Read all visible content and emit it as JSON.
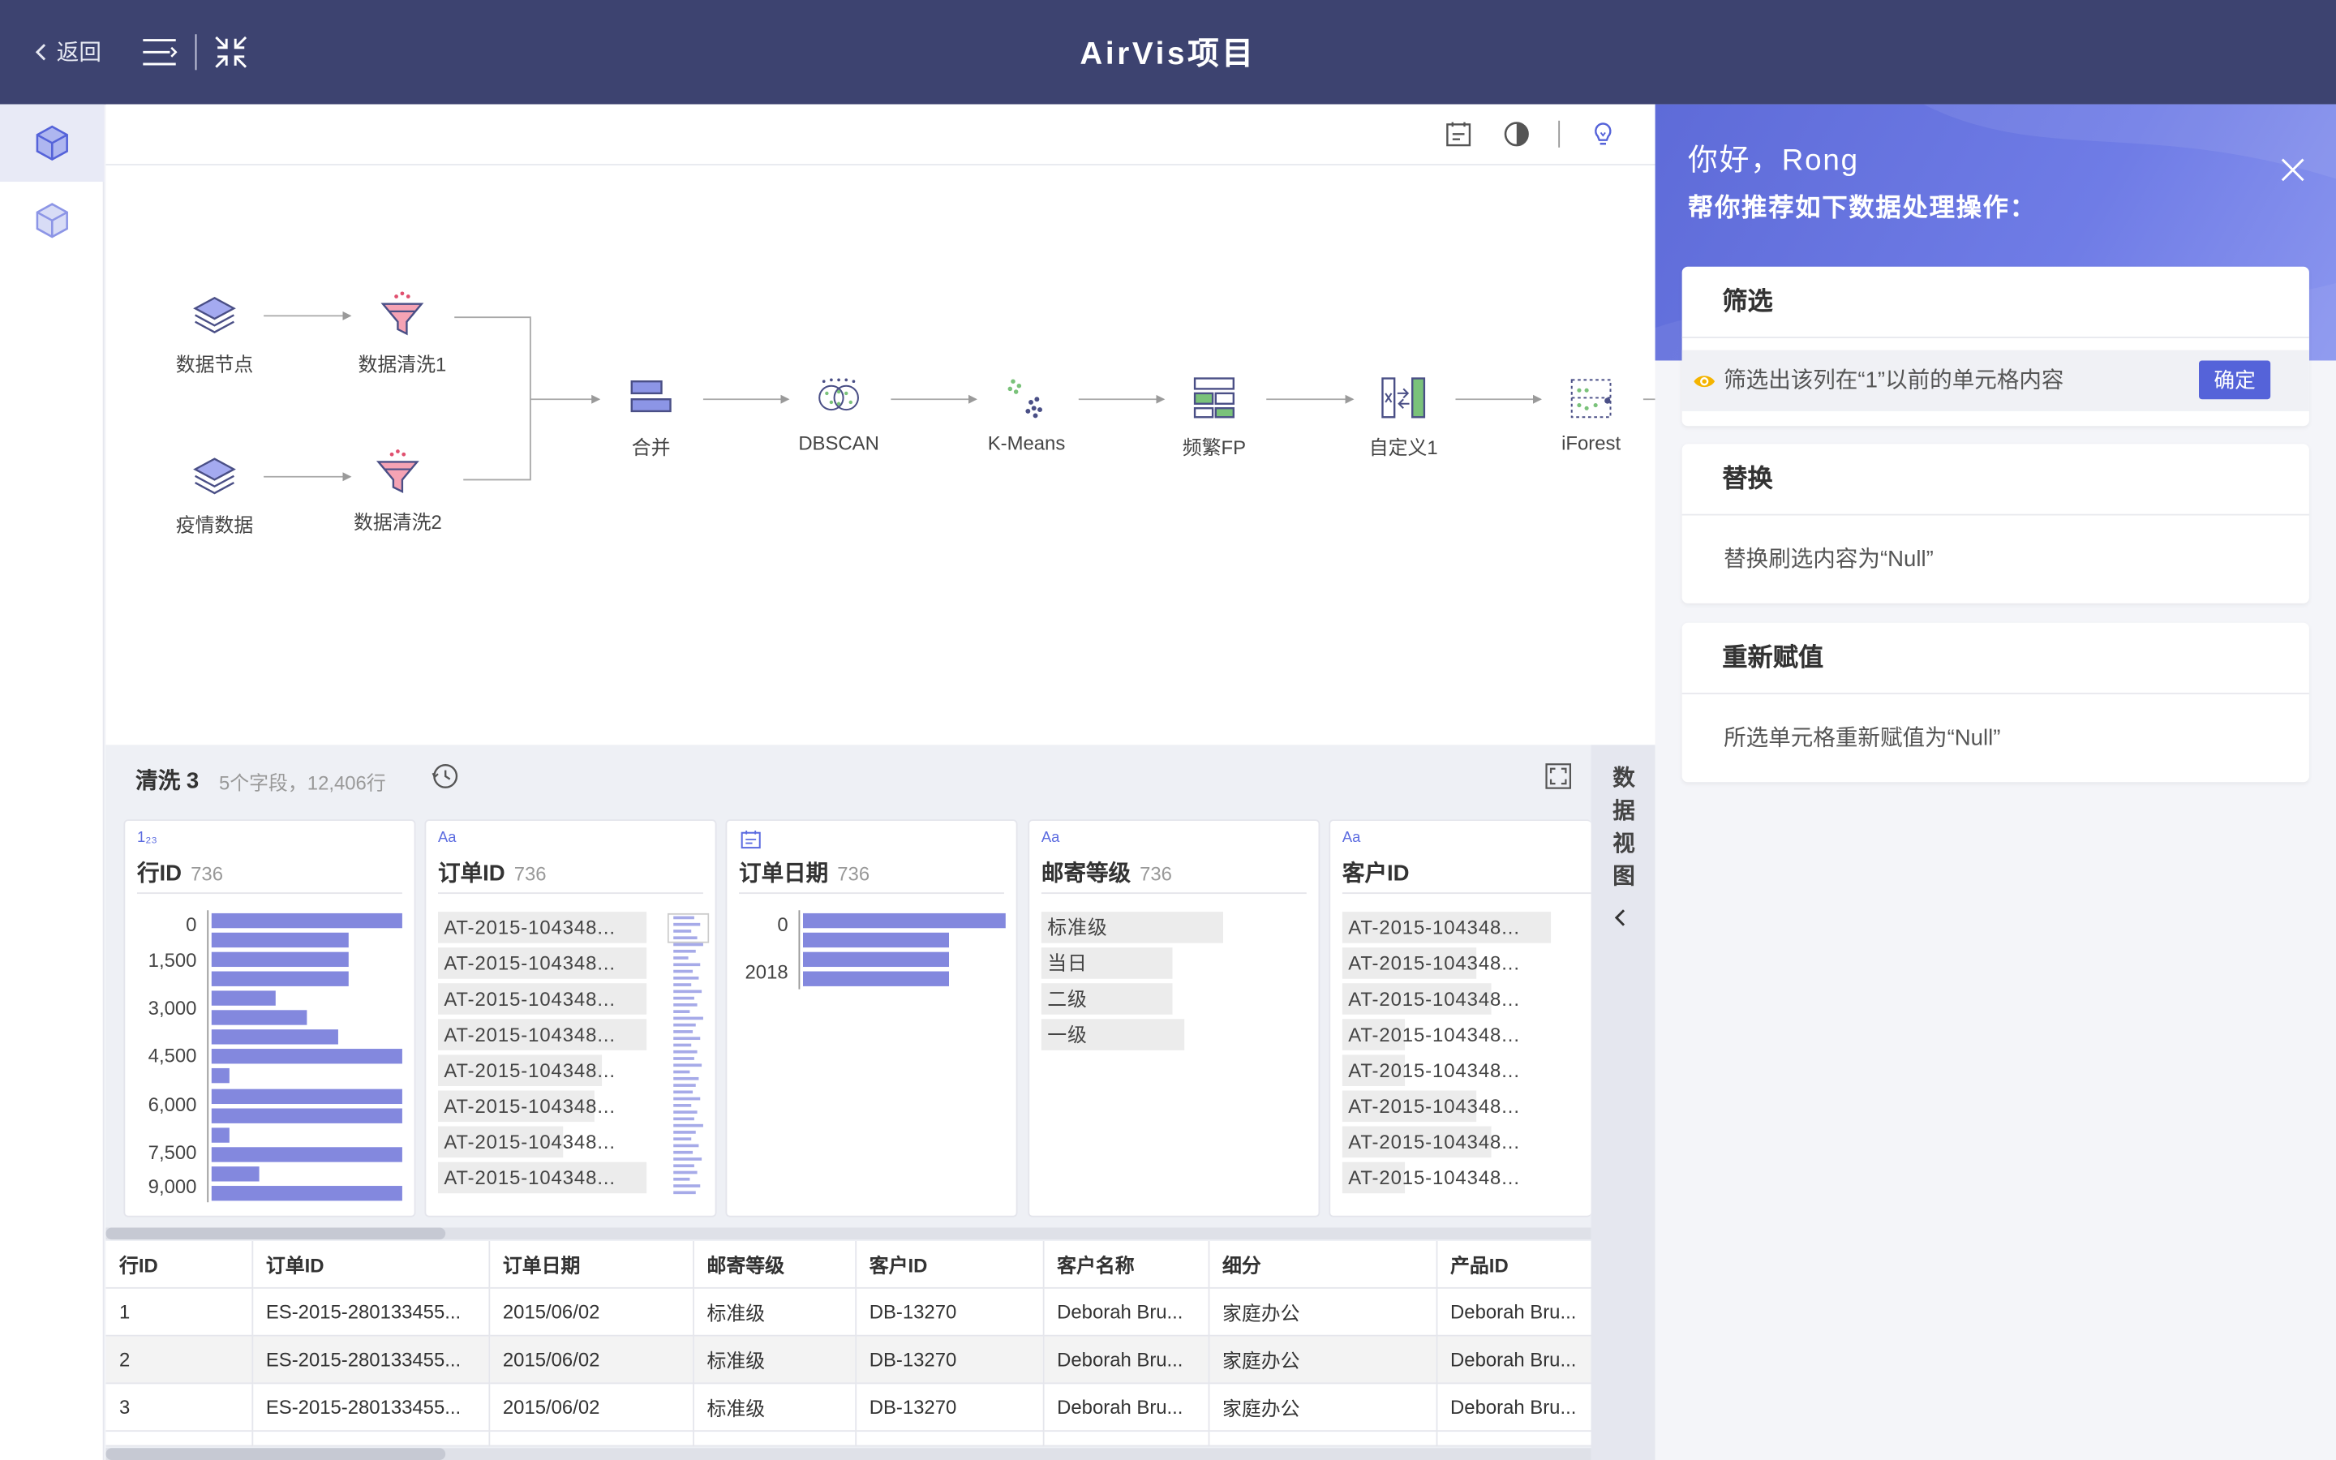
{
  "app": {
    "title": "AirVis项目",
    "back_label": "返回"
  },
  "colors": {
    "topbar": "#3d4370",
    "accent": "#5563d9",
    "bar": "#8388de"
  },
  "toolbar_icons": [
    "menu-icon",
    "collapse-icon"
  ],
  "canvas_toolbar_icons": [
    "calendar-icon",
    "contrast-icon",
    "lightbulb-icon"
  ],
  "flow": {
    "nodes": [
      {
        "label": "数据节点",
        "icon": "layers-icon"
      },
      {
        "label": "数据清洗1",
        "icon": "funnel-icon"
      },
      {
        "label": "疫情数据",
        "icon": "layers-icon"
      },
      {
        "label": "数据清洗2",
        "icon": "funnel-icon"
      },
      {
        "label": "合并",
        "icon": "merge-icon"
      },
      {
        "label": "DBSCAN",
        "icon": "dbscan-icon"
      },
      {
        "label": "K-Means",
        "icon": "kmeans-icon"
      },
      {
        "label": "频繁FP",
        "icon": "fp-icon"
      },
      {
        "label": "自定义1",
        "icon": "custom-icon"
      },
      {
        "label": "iForest",
        "icon": "iforest-icon"
      }
    ]
  },
  "data_panel": {
    "title": "清洗 3",
    "subtitle": "5个字段，12,406行",
    "side_tab": "数据视图",
    "columns": [
      {
        "type": "1₂₃",
        "name": "行ID",
        "count": "736",
        "ticks": [
          "0",
          "1,500",
          "3,000",
          "4,500",
          "6,000",
          "7,500",
          "9,000"
        ]
      },
      {
        "type": "Aa",
        "name": "订单ID",
        "count": "736",
        "values": [
          "AT-2015-104348...",
          "AT-2015-104348...",
          "AT-2015-104348...",
          "AT-2015-104348...",
          "AT-2015-104348...",
          "AT-2015-104348...",
          "AT-2015-104348...",
          "AT-2015-104348..."
        ]
      },
      {
        "type": "date",
        "name": "订单日期",
        "count": "736",
        "ticks": [
          "0",
          "2018"
        ]
      },
      {
        "type": "Aa",
        "name": "邮寄等级",
        "count": "736",
        "values": [
          "标准级",
          "当日",
          "二级",
          "一级"
        ]
      },
      {
        "type": "Aa",
        "name": "客户ID",
        "count": "",
        "values": [
          "AT-2015-104348...",
          "AT-2015-104348...",
          "AT-2015-104348...",
          "AT-2015-104348...",
          "AT-2015-104348...",
          "AT-2015-104348...",
          "AT-2015-104348...",
          "AT-2015-104348..."
        ]
      }
    ],
    "table": {
      "headers": [
        "行ID",
        "订单ID",
        "订单日期",
        "邮寄等级",
        "客户ID",
        "客户名称",
        "细分",
        "产品ID"
      ],
      "rows": [
        [
          "1",
          "ES-2015-280133455...",
          "2015/06/02",
          "标准级",
          "DB-13270",
          "Deborah Bru...",
          "家庭办公",
          "Deborah Bru..."
        ],
        [
          "2",
          "ES-2015-280133455...",
          "2015/06/02",
          "标准级",
          "DB-13270",
          "Deborah Bru...",
          "家庭办公",
          "Deborah Bru..."
        ],
        [
          "3",
          "ES-2015-280133455...",
          "2015/06/02",
          "标准级",
          "DB-13270",
          "Deborah Bru...",
          "家庭办公",
          "Deborah Bru..."
        ]
      ]
    }
  },
  "assistant": {
    "greeting": "你好，Rong",
    "subtitle": "帮你推荐如下数据处理操作：",
    "suggestions": [
      {
        "title": "筛选",
        "text": "筛选出该列在“1”以前的单元格内容",
        "button": "确定"
      },
      {
        "title": "替换",
        "text": "替换刷选内容为“Null”"
      },
      {
        "title": "重新赋值",
        "text": "所选单元格重新赋值为“Null”"
      }
    ]
  }
}
